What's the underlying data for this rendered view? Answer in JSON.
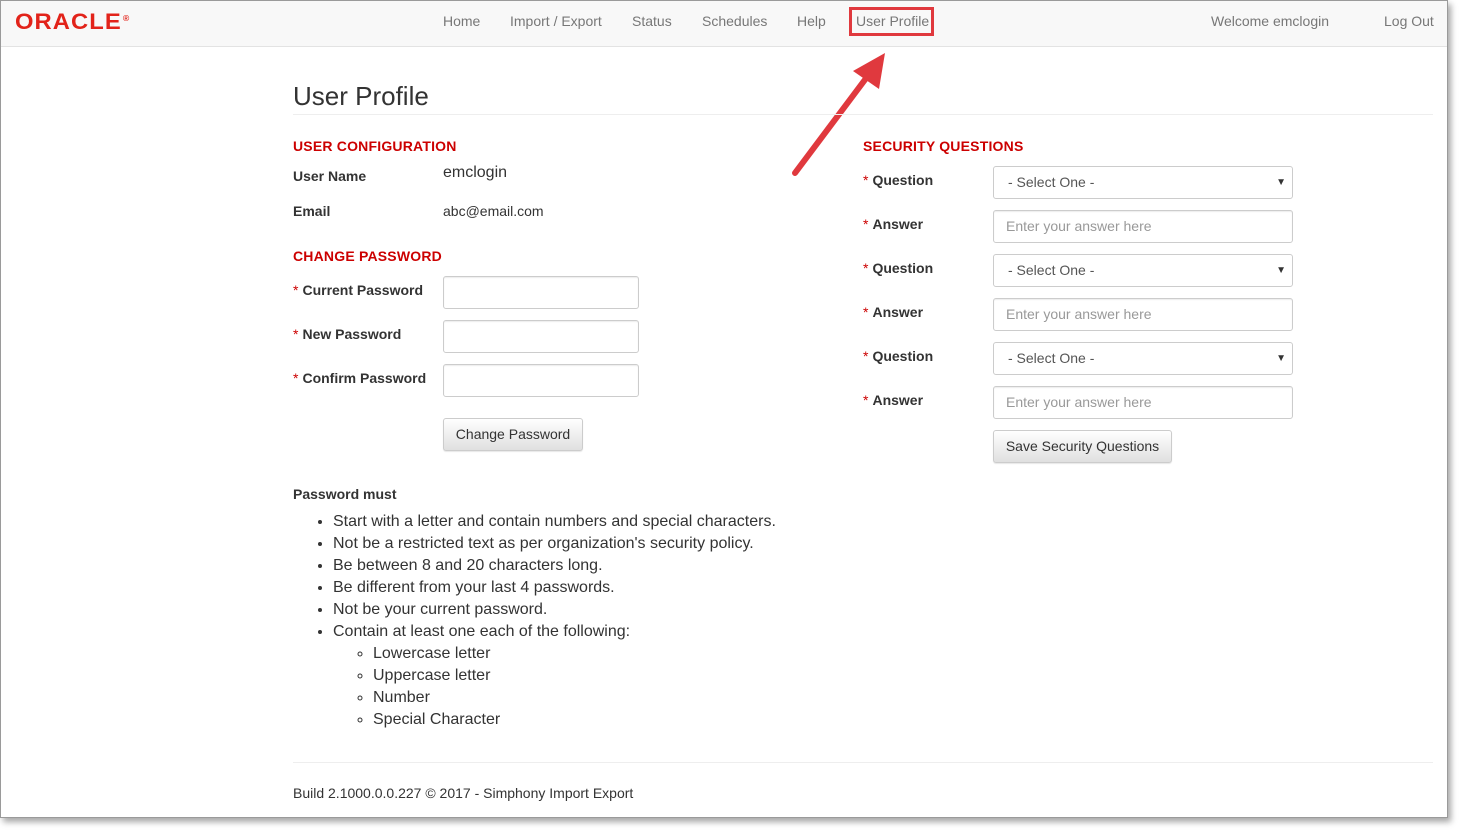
{
  "brand": {
    "logo_text": "ORACLE",
    "logo_mark": "®",
    "accent": "#e2231a"
  },
  "nav": {
    "items": [
      "Home",
      "Import / Export",
      "Status",
      "Schedules",
      "Help",
      "User Profile"
    ],
    "active": "User Profile",
    "welcome": "Welcome emclogin",
    "logout": "Log Out"
  },
  "page": {
    "title": "User Profile"
  },
  "user_config": {
    "heading": "USER CONFIGURATION",
    "username_label": "User Name",
    "username_value": "emclogin",
    "email_label": "Email",
    "email_value": "abc@email.com"
  },
  "change_password": {
    "heading": "CHANGE PASSWORD",
    "required_mark": "*",
    "current_label": "Current Password",
    "new_label": "New Password",
    "confirm_label": "Confirm Password",
    "button": "Change Password"
  },
  "security": {
    "heading": "SECURITY QUESTIONS",
    "question_label": "Question",
    "answer_label": "Answer",
    "select_placeholder": "- Select One -",
    "answer_placeholder": "Enter your answer here",
    "button": "Save Security Questions"
  },
  "rules": {
    "title": "Password must",
    "items": [
      "Start with a letter and contain numbers and special characters.",
      "Not be a restricted text as per organization's security policy.",
      "Be between 8 and 20 characters long.",
      "Be different from your last 4 passwords.",
      "Not be your current password.",
      "Contain at least one each of the following:"
    ],
    "sub_items": [
      "Lowercase letter",
      "Uppercase letter",
      "Number",
      "Special Character"
    ]
  },
  "footer": {
    "text": "Build 2.1000.0.0.227 © 2017 - Simphony Import Export"
  },
  "colors": {
    "heading_red": "#cc0000",
    "highlight_box": "#e0393e"
  }
}
